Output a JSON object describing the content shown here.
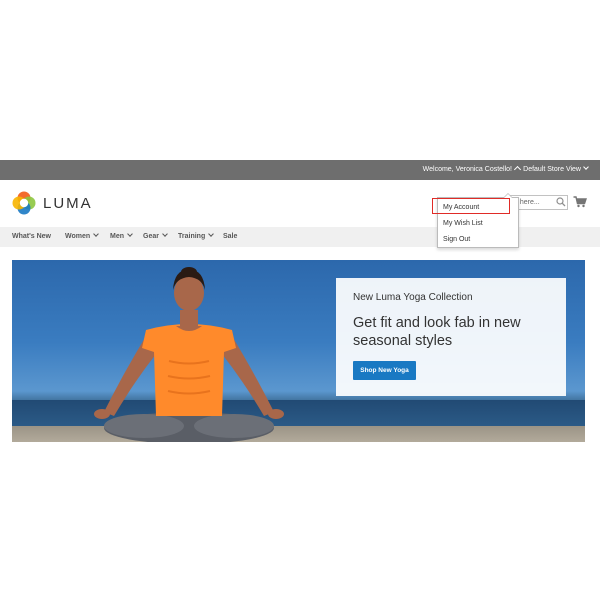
{
  "panel": {
    "welcome": "Welcome, Veronica Costello!",
    "store_view": "Default Store View"
  },
  "header": {
    "logo_text": "LUMA",
    "search_placeholder": "e here...",
    "colors": {
      "logo_orange": "#f26322",
      "logo_green": "#8dc63f",
      "logo_blue": "#1979c3",
      "logo_yellow": "#f7b500"
    }
  },
  "account_menu": {
    "items": [
      "My Account",
      "My Wish List",
      "Sign Out"
    ],
    "highlight_color": "#e02b27"
  },
  "nav": {
    "items": [
      {
        "label": "What's New",
        "has_dropdown": false
      },
      {
        "label": "Women",
        "has_dropdown": true
      },
      {
        "label": "Men",
        "has_dropdown": true
      },
      {
        "label": "Gear",
        "has_dropdown": true
      },
      {
        "label": "Training",
        "has_dropdown": true
      },
      {
        "label": "Sale",
        "has_dropdown": false
      }
    ]
  },
  "hero": {
    "subtitle": "New Luma Yoga Collection",
    "title": "Get fit and look fab in new seasonal styles",
    "button_label": "Shop New Yoga",
    "button_color": "#1979c3"
  }
}
